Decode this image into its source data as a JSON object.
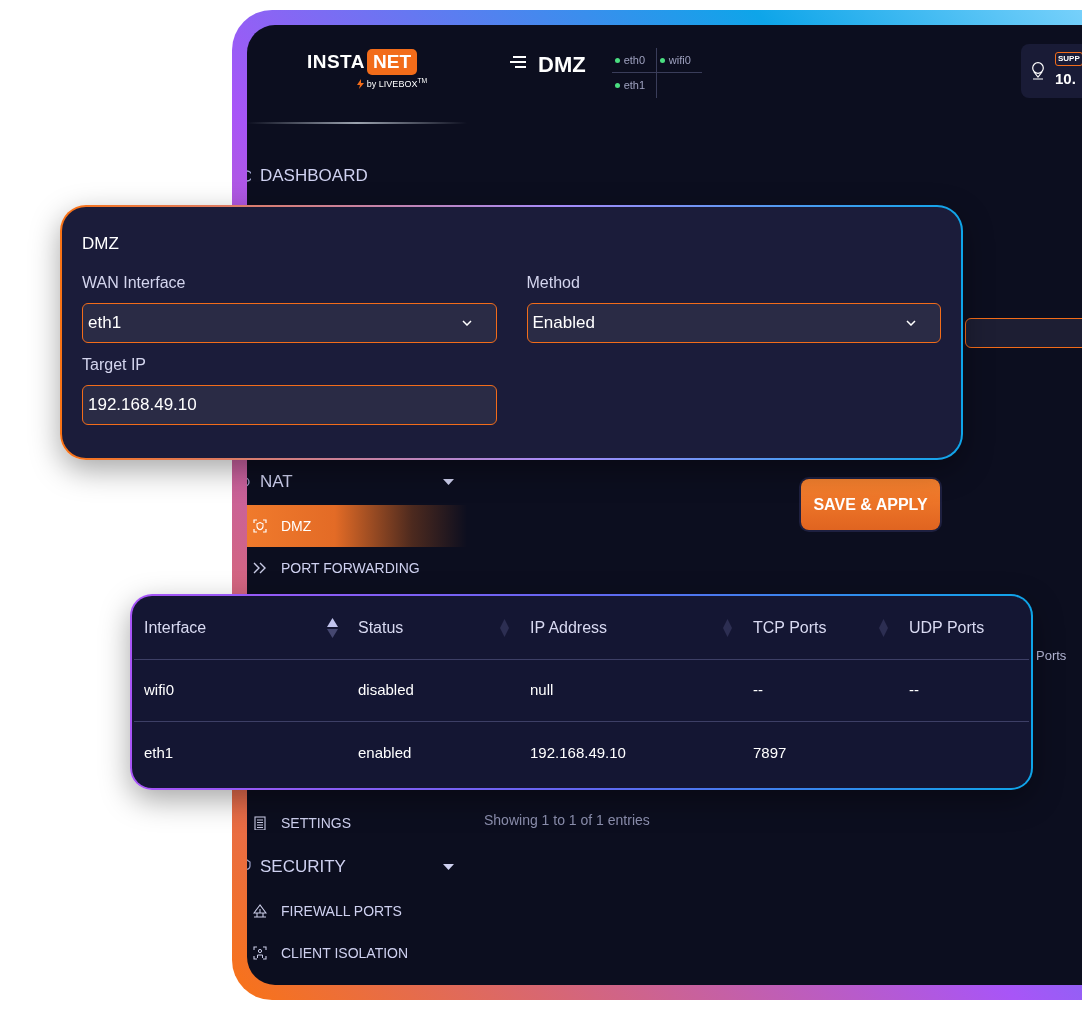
{
  "logo": {
    "brand_left": "INSTA",
    "brand_right": "NET",
    "tagline": "by LIVEBOX$^{TM}$"
  },
  "header": {
    "title": "DMZ",
    "interfaces": [
      {
        "name": "eth0",
        "up": true
      },
      {
        "name": "wifi0",
        "up": true
      },
      {
        "name": "eth1",
        "up": true
      }
    ],
    "ip_card": {
      "badge": "SUPP",
      "value": "10."
    }
  },
  "sidebar": {
    "items": [
      {
        "kind": "section",
        "label": "DASHBOARD"
      },
      {
        "kind": "section",
        "label": "NAT",
        "expanded": true
      },
      {
        "kind": "item",
        "label": "DMZ",
        "selected": true
      },
      {
        "kind": "item",
        "label": "PORT FORWARDING",
        "selected": false
      },
      {
        "kind": "item",
        "label": "SETTINGS",
        "selected": false
      },
      {
        "kind": "section",
        "label": "SECURITY",
        "expanded": true
      },
      {
        "kind": "item",
        "label": "FIREWALL PORTS",
        "selected": false
      },
      {
        "kind": "item",
        "label": "CLIENT ISOLATION",
        "selected": false
      }
    ]
  },
  "save_button": "SAVE & APPLY",
  "background_table": {
    "column_label": "Ports",
    "footer": "Showing 1 to 1 of 1 entries"
  },
  "dmz_form": {
    "title": "DMZ",
    "fields": [
      {
        "kind": "select",
        "label": "WAN Interface",
        "value": "eth1"
      },
      {
        "kind": "select",
        "label": "Method",
        "value": "Enabled"
      },
      {
        "kind": "input",
        "label": "Target IP",
        "value": "192.168.49.10"
      }
    ]
  },
  "table": {
    "columns": [
      {
        "label": "Interface",
        "sorted": true
      },
      {
        "label": "Status",
        "sorted": false
      },
      {
        "label": "IP Address",
        "sorted": false
      },
      {
        "label": "TCP Ports",
        "sorted": false
      },
      {
        "label": "UDP Ports"
      }
    ],
    "rows": [
      [
        "wifi0",
        "disabled",
        "null",
        "--",
        "--"
      ],
      [
        "eth1",
        "enabled",
        "192.168.49.10",
        "7897",
        ""
      ]
    ]
  }
}
